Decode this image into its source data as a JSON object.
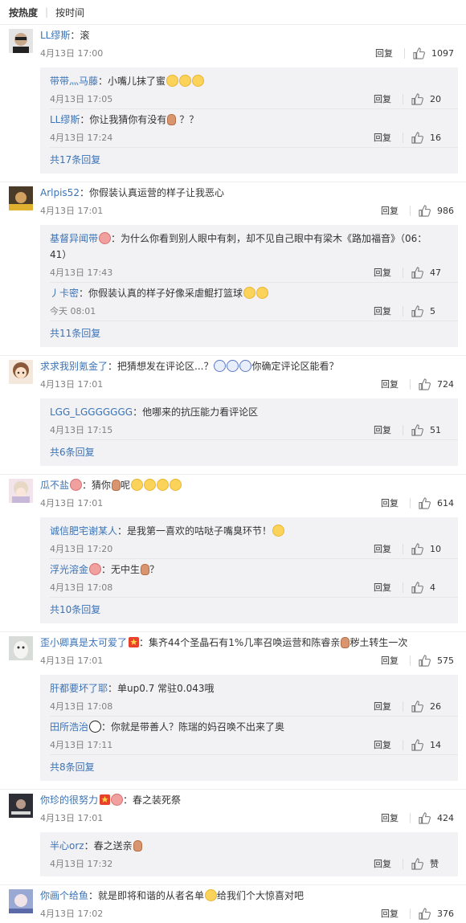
{
  "sort": {
    "active": "按热度",
    "inactive": "按时间"
  },
  "reply_label": "回复",
  "comments": [
    {
      "user": "LL缪斯",
      "sep": "：",
      "text": "滚",
      "time": "4月13日 17:00",
      "likes": "1097",
      "avatar_color": "#d7d7d7",
      "replies": [
        {
          "user": "带带灬马藤",
          "sep": "：",
          "text": "小嘴儿抹了蜜",
          "time": "4月13日 17:05",
          "likes": "20"
        },
        {
          "user": "LL缪斯",
          "sep": "：",
          "text": "你让我猜你有没有",
          "text2": " ？？",
          "time": "4月13日 17:24",
          "likes": "16"
        }
      ],
      "more": "共17条回复"
    },
    {
      "user": "Arlpis52",
      "sep": "：",
      "text": "你假装认真运营的样子让我恶心",
      "time": "4月13日 17:01",
      "likes": "986",
      "avatar_color": "#5a4a34",
      "replies": [
        {
          "user": "基督异闻带",
          "sep": "：",
          "text": "为什么你看到别人眼中有刺，却不见自己眼中有梁木《路加福音》（06：41）",
          "time": "4月13日 17:43",
          "likes": "47"
        },
        {
          "user": "丿卡密",
          "sep": "：",
          "text": "你假装认真的样子好像采虐鲲打篮球",
          "time": "今天 08:01",
          "likes": "5"
        }
      ],
      "more": "共11条回复"
    },
    {
      "user": "求求我别氪金了",
      "sep": "：",
      "text": "把猜想发在评论区...？",
      "text2": "你确定评论区能看？",
      "time": "4月13日 17:01",
      "likes": "724",
      "avatar_color": "#b08060",
      "replies": [
        {
          "user": "LGG_LGGGGGGG",
          "sep": "：",
          "text": "他哪来的抗压能力看评论区",
          "time": "4月13日 17:15",
          "likes": "51"
        }
      ],
      "more": "共6条回复"
    },
    {
      "user": "瓜不盐",
      "sep": "：",
      "text": "猜你",
      "text2": "呢",
      "time": "4月13日 17:01",
      "likes": "614",
      "avatar_color": "#e8d0d8",
      "replies": [
        {
          "user": "诚信肥宅谢某人",
          "sep": "：",
          "text": "是我第一喜欢的咕哒子嘴臭环节！",
          "time": "4月13日 17:20",
          "likes": "10"
        },
        {
          "user": "浮光溶金",
          "sep": "：",
          "text": "无中生",
          "text2": "？",
          "time": "4月13日 17:08",
          "likes": "4"
        }
      ],
      "more": "共10条回复"
    },
    {
      "user": "歪小卿真是太可爱了",
      "sep": "：",
      "text": "集齐44个圣晶石有1%几率召唤运营和陈睿亲",
      "text2": "秽土转生一次",
      "time": "4月13日 17:01",
      "likes": "575",
      "avatar_color": "#c8ccc8",
      "replies": [
        {
          "user": "肝都要坏了耶",
          "sep": "：",
          "text": "单up0.7 常驻0.043哦",
          "time": "4月13日 17:08",
          "likes": "26"
        },
        {
          "user": "田所浩治",
          "sep": "：",
          "text": "你就是带善人？陈瑞的妈召唤不出来了奥",
          "time": "4月13日 17:11",
          "likes": "14"
        }
      ],
      "more": "共8条回复"
    },
    {
      "user": "你珍的很努力",
      "sep": "：",
      "text": "春之装死祭",
      "time": "4月13日 17:01",
      "likes": "424",
      "avatar_color": "#3a3a42",
      "replies": [
        {
          "user": "半心orz",
          "sep": "：",
          "text": "春之送亲",
          "time": "4月13日 17:32",
          "likes": "赞"
        }
      ],
      "more": ""
    },
    {
      "user": "你画个给鱼",
      "sep": "：",
      "text": "就是即将和谐的从者名单",
      "text2": "给我们个大惊喜对吧",
      "time": "4月13日 17:02",
      "likes": "376",
      "avatar_color": "#8a9ac8",
      "replies": [],
      "more": ""
    }
  ]
}
